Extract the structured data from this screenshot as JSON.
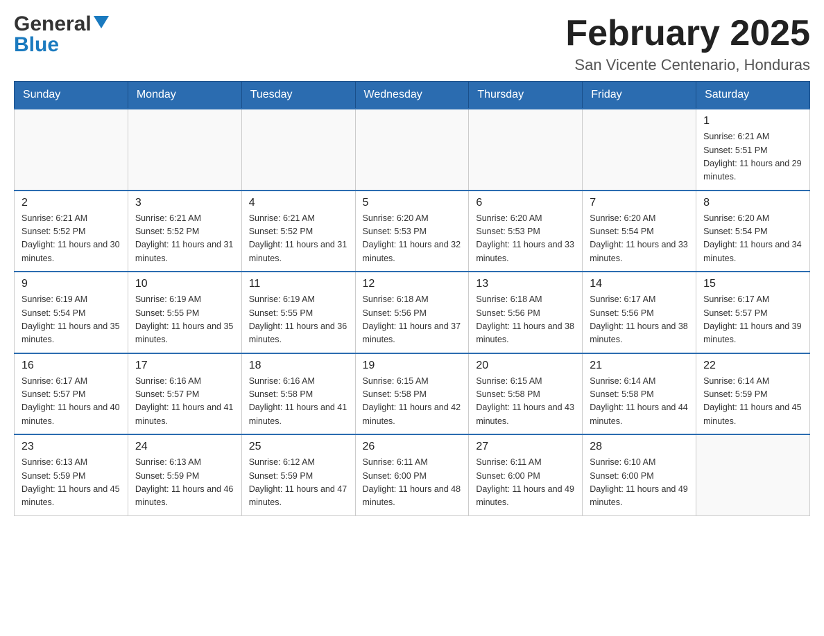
{
  "header": {
    "logo_general": "General",
    "logo_blue": "Blue",
    "month_title": "February 2025",
    "location": "San Vicente Centenario, Honduras"
  },
  "weekdays": [
    "Sunday",
    "Monday",
    "Tuesday",
    "Wednesday",
    "Thursday",
    "Friday",
    "Saturday"
  ],
  "weeks": [
    {
      "days": [
        {
          "number": "",
          "sunrise": "",
          "sunset": "",
          "daylight": ""
        },
        {
          "number": "",
          "sunrise": "",
          "sunset": "",
          "daylight": ""
        },
        {
          "number": "",
          "sunrise": "",
          "sunset": "",
          "daylight": ""
        },
        {
          "number": "",
          "sunrise": "",
          "sunset": "",
          "daylight": ""
        },
        {
          "number": "",
          "sunrise": "",
          "sunset": "",
          "daylight": ""
        },
        {
          "number": "",
          "sunrise": "",
          "sunset": "",
          "daylight": ""
        },
        {
          "number": "1",
          "sunrise": "Sunrise: 6:21 AM",
          "sunset": "Sunset: 5:51 PM",
          "daylight": "Daylight: 11 hours and 29 minutes."
        }
      ]
    },
    {
      "days": [
        {
          "number": "2",
          "sunrise": "Sunrise: 6:21 AM",
          "sunset": "Sunset: 5:52 PM",
          "daylight": "Daylight: 11 hours and 30 minutes."
        },
        {
          "number": "3",
          "sunrise": "Sunrise: 6:21 AM",
          "sunset": "Sunset: 5:52 PM",
          "daylight": "Daylight: 11 hours and 31 minutes."
        },
        {
          "number": "4",
          "sunrise": "Sunrise: 6:21 AM",
          "sunset": "Sunset: 5:52 PM",
          "daylight": "Daylight: 11 hours and 31 minutes."
        },
        {
          "number": "5",
          "sunrise": "Sunrise: 6:20 AM",
          "sunset": "Sunset: 5:53 PM",
          "daylight": "Daylight: 11 hours and 32 minutes."
        },
        {
          "number": "6",
          "sunrise": "Sunrise: 6:20 AM",
          "sunset": "Sunset: 5:53 PM",
          "daylight": "Daylight: 11 hours and 33 minutes."
        },
        {
          "number": "7",
          "sunrise": "Sunrise: 6:20 AM",
          "sunset": "Sunset: 5:54 PM",
          "daylight": "Daylight: 11 hours and 33 minutes."
        },
        {
          "number": "8",
          "sunrise": "Sunrise: 6:20 AM",
          "sunset": "Sunset: 5:54 PM",
          "daylight": "Daylight: 11 hours and 34 minutes."
        }
      ]
    },
    {
      "days": [
        {
          "number": "9",
          "sunrise": "Sunrise: 6:19 AM",
          "sunset": "Sunset: 5:54 PM",
          "daylight": "Daylight: 11 hours and 35 minutes."
        },
        {
          "number": "10",
          "sunrise": "Sunrise: 6:19 AM",
          "sunset": "Sunset: 5:55 PM",
          "daylight": "Daylight: 11 hours and 35 minutes."
        },
        {
          "number": "11",
          "sunrise": "Sunrise: 6:19 AM",
          "sunset": "Sunset: 5:55 PM",
          "daylight": "Daylight: 11 hours and 36 minutes."
        },
        {
          "number": "12",
          "sunrise": "Sunrise: 6:18 AM",
          "sunset": "Sunset: 5:56 PM",
          "daylight": "Daylight: 11 hours and 37 minutes."
        },
        {
          "number": "13",
          "sunrise": "Sunrise: 6:18 AM",
          "sunset": "Sunset: 5:56 PM",
          "daylight": "Daylight: 11 hours and 38 minutes."
        },
        {
          "number": "14",
          "sunrise": "Sunrise: 6:17 AM",
          "sunset": "Sunset: 5:56 PM",
          "daylight": "Daylight: 11 hours and 38 minutes."
        },
        {
          "number": "15",
          "sunrise": "Sunrise: 6:17 AM",
          "sunset": "Sunset: 5:57 PM",
          "daylight": "Daylight: 11 hours and 39 minutes."
        }
      ]
    },
    {
      "days": [
        {
          "number": "16",
          "sunrise": "Sunrise: 6:17 AM",
          "sunset": "Sunset: 5:57 PM",
          "daylight": "Daylight: 11 hours and 40 minutes."
        },
        {
          "number": "17",
          "sunrise": "Sunrise: 6:16 AM",
          "sunset": "Sunset: 5:57 PM",
          "daylight": "Daylight: 11 hours and 41 minutes."
        },
        {
          "number": "18",
          "sunrise": "Sunrise: 6:16 AM",
          "sunset": "Sunset: 5:58 PM",
          "daylight": "Daylight: 11 hours and 41 minutes."
        },
        {
          "number": "19",
          "sunrise": "Sunrise: 6:15 AM",
          "sunset": "Sunset: 5:58 PM",
          "daylight": "Daylight: 11 hours and 42 minutes."
        },
        {
          "number": "20",
          "sunrise": "Sunrise: 6:15 AM",
          "sunset": "Sunset: 5:58 PM",
          "daylight": "Daylight: 11 hours and 43 minutes."
        },
        {
          "number": "21",
          "sunrise": "Sunrise: 6:14 AM",
          "sunset": "Sunset: 5:58 PM",
          "daylight": "Daylight: 11 hours and 44 minutes."
        },
        {
          "number": "22",
          "sunrise": "Sunrise: 6:14 AM",
          "sunset": "Sunset: 5:59 PM",
          "daylight": "Daylight: 11 hours and 45 minutes."
        }
      ]
    },
    {
      "days": [
        {
          "number": "23",
          "sunrise": "Sunrise: 6:13 AM",
          "sunset": "Sunset: 5:59 PM",
          "daylight": "Daylight: 11 hours and 45 minutes."
        },
        {
          "number": "24",
          "sunrise": "Sunrise: 6:13 AM",
          "sunset": "Sunset: 5:59 PM",
          "daylight": "Daylight: 11 hours and 46 minutes."
        },
        {
          "number": "25",
          "sunrise": "Sunrise: 6:12 AM",
          "sunset": "Sunset: 5:59 PM",
          "daylight": "Daylight: 11 hours and 47 minutes."
        },
        {
          "number": "26",
          "sunrise": "Sunrise: 6:11 AM",
          "sunset": "Sunset: 6:00 PM",
          "daylight": "Daylight: 11 hours and 48 minutes."
        },
        {
          "number": "27",
          "sunrise": "Sunrise: 6:11 AM",
          "sunset": "Sunset: 6:00 PM",
          "daylight": "Daylight: 11 hours and 49 minutes."
        },
        {
          "number": "28",
          "sunrise": "Sunrise: 6:10 AM",
          "sunset": "Sunset: 6:00 PM",
          "daylight": "Daylight: 11 hours and 49 minutes."
        },
        {
          "number": "",
          "sunrise": "",
          "sunset": "",
          "daylight": ""
        }
      ]
    }
  ]
}
